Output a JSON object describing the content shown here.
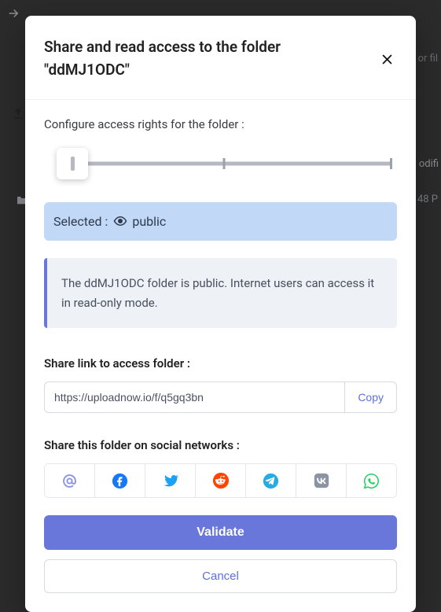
{
  "bg": {
    "right1": "or fil",
    "right2": "odifi",
    "right3": "48 P"
  },
  "modal": {
    "title": "Share and read access to the folder \"ddMJ1ODC\"",
    "configure_label": "Configure access rights for the folder :",
    "selected_prefix": "Selected :",
    "selected_value": "public",
    "info_text": "The ddMJ1ODC folder is public. Internet users can access it in read-only mode.",
    "share_link_label": "Share link to access folder :",
    "share_link_value": "https://uploadnow.io/f/q5gq3bn",
    "copy_label": "Copy",
    "social_label": "Share this folder on social networks :",
    "validate_label": "Validate",
    "cancel_label": "Cancel"
  }
}
